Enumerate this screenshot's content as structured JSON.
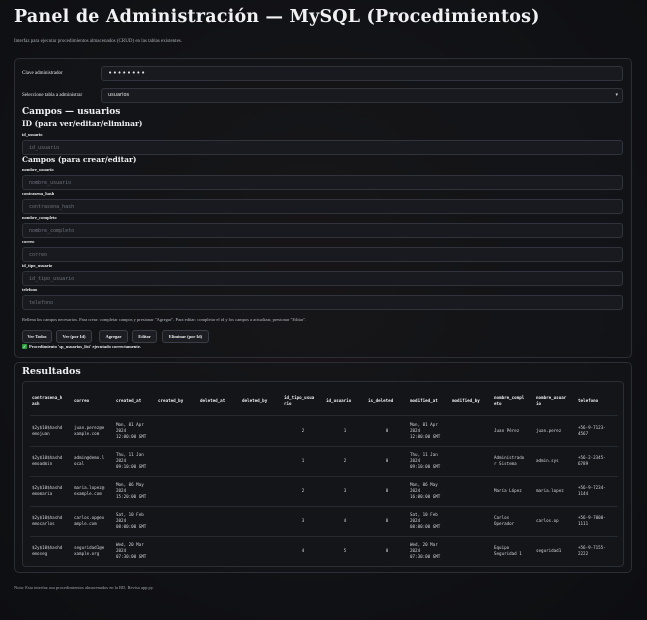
{
  "header": {
    "title": "Panel de Administración — MySQL (Procedimientos)",
    "subtitle": "Interfaz para ejecutar procedimientos almacenados (CRUD) en las tablas existentes."
  },
  "auth": {
    "password_label": "Clave administrador",
    "password_value": "••••••••",
    "table_label": "Seleccione tabla a administrar",
    "table_selected": "usuarios"
  },
  "fields": {
    "section_title": "Campos — usuarios",
    "id_title": "ID (para ver/editar/eliminar)",
    "id_label": "id_usuario",
    "id_placeholder": "id_usuario",
    "create_title": "Campos (para crear/editar)",
    "items": [
      {
        "label": "nombre_usuario",
        "placeholder": "nombre_usuario"
      },
      {
        "label": "contrasena_hash",
        "placeholder": "contrasena_hash"
      },
      {
        "label": "nombre_completo",
        "placeholder": "nombre_completo"
      },
      {
        "label": "correo",
        "placeholder": "correo"
      },
      {
        "label": "id_tipo_usuario",
        "placeholder": "id_tipo_usuario"
      },
      {
        "label": "telefono",
        "placeholder": "telefono"
      }
    ],
    "help": "Rellena los campos necesarios. Para crear: completar campos y presionar \"Agregar\". Para editar: completar el id y los campos a actualizar, presionar \"Editar\"."
  },
  "actions": {
    "view_all": "Ver Todos",
    "view_by_id": "Ver (por Id)",
    "add": "Agregar",
    "edit": "Editar",
    "delete": "Eliminar (por Id)"
  },
  "status": {
    "icon": "check-icon",
    "text": "Procedimiento 'sp_usuarios_list' ejecutado correctamente."
  },
  "results": {
    "title": "Resultados",
    "columns": [
      "contrasena_h\nash",
      "correo",
      "created_at",
      "created_by",
      "deleted_at",
      "deleted_by",
      "id_tipo_usua\nrio",
      "id_usuario",
      "is_deleted",
      "modified_at",
      "modified_by",
      "nombre_compl\neto",
      "nombre_usuar\nio",
      "telefono"
    ],
    "rows": [
      [
        "$2y$10$hashd\nemojuan",
        "juan.perez@e\nxample.com",
        "Mon, 01 Apr\n2024\n12:00:00 GMT",
        "",
        "",
        "",
        "2",
        "1",
        "0",
        "Mon, 01 Apr\n2024\n12:00:00 GMT",
        "",
        "Juan Pérez",
        "juan.perez",
        "+56-9-7123-\n4567"
      ],
      [
        "$2y$10$hashd\nemoadmin",
        "admin@demo.l\nocal",
        "Thu, 11 Jan\n2024\n09:10:00 GMT",
        "",
        "",
        "",
        "1",
        "2",
        "0",
        "Thu, 11 Jan\n2024\n09:10:00 GMT",
        "",
        "Administrado\nr Sistema",
        "admin.sys",
        "+56-2-2345-\n6789"
      ],
      [
        "$2y$10$hashd\nemomaria",
        "maria.lopez@\nexample.com",
        "Mon, 06 May\n2024\n15:20:00 GMT",
        "",
        "",
        "",
        "2",
        "3",
        "0",
        "Mon, 06 May\n2024\n16:00:00 GMT",
        "",
        "María López",
        "maria.lopez",
        "+56-9-7234-\n1144"
      ],
      [
        "$2y$10$hashd\nemocarlos",
        "carlos.op@ex\nample.com",
        "Sat, 10 Feb\n2024\n08:00:00 GMT",
        "",
        "",
        "",
        "3",
        "4",
        "0",
        "Sat, 10 Feb\n2024\n08:00:00 GMT",
        "",
        "Carlos\nOperador",
        "carlos.op",
        "+56-9-7000-\n1111"
      ],
      [
        "$2y$10$hashd\nemoseg",
        "seguridad1@e\nxample.org",
        "Wed, 20 Mar\n2024\n07:30:00 GMT",
        "",
        "",
        "",
        "4",
        "5",
        "0",
        "Wed, 20 Mar\n2024\n07:30:00 GMT",
        "",
        "Equipo\nSeguridad 1",
        "seguridad1",
        "+56-9-7155-\n2222"
      ]
    ]
  },
  "footer": {
    "text": "Nota: Esta interfaz usa procedimientos almacenados en la BD. Revisa app.py."
  }
}
